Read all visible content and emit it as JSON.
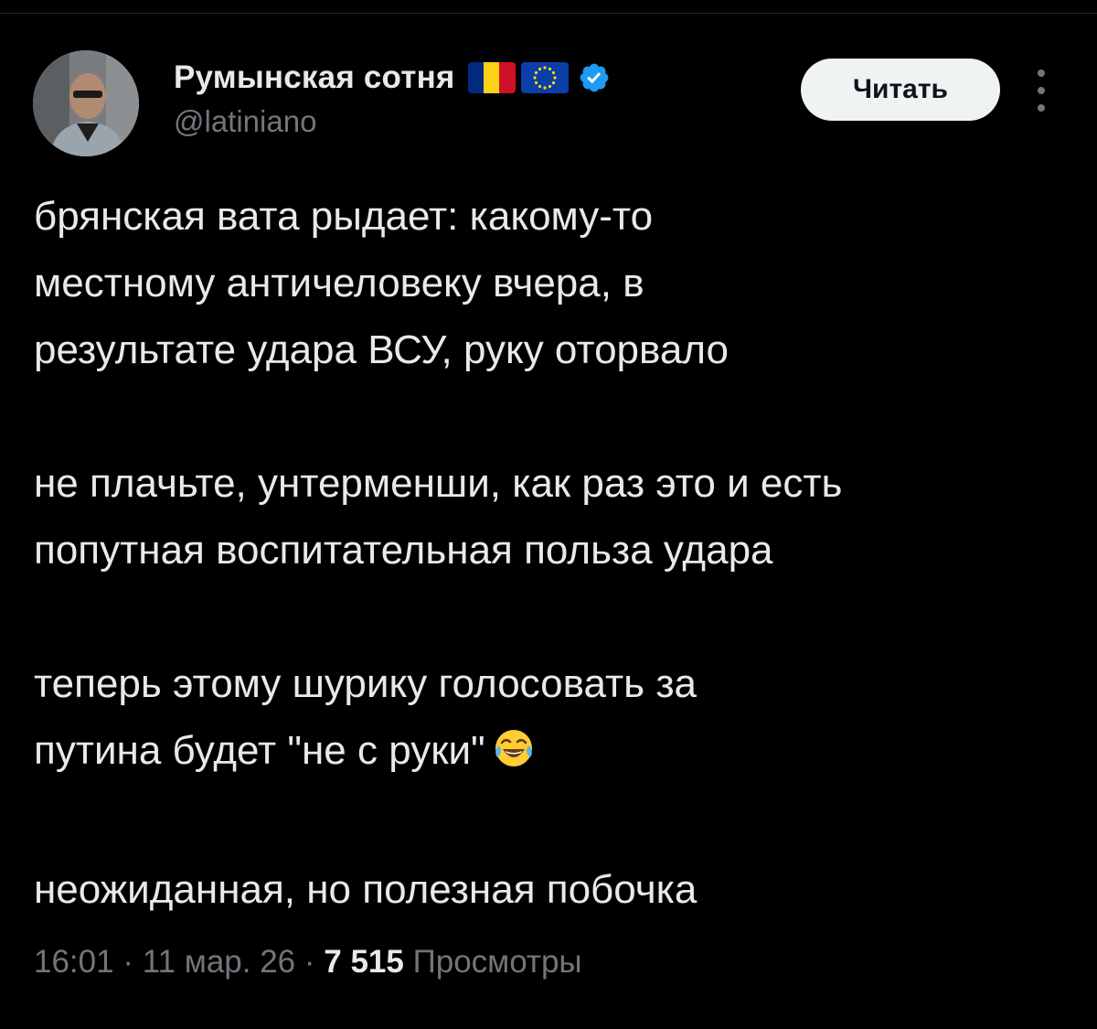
{
  "author": {
    "display_name": "Румынская сотня",
    "handle": "@latiniano"
  },
  "flags": {
    "romania": [
      "#002b7f",
      "#fcd116",
      "#ce1126"
    ],
    "eu": "#0b3ea8"
  },
  "icons": {
    "verified": "verified-badge-icon",
    "more": "more-vertical-icon",
    "emoji": "face-with-tears-of-joy"
  },
  "colors": {
    "background": "#000000",
    "text": "#e7e9ea",
    "muted": "#71767b",
    "verified": "#1d9bf0",
    "button_bg": "#eff3f4"
  },
  "follow_button": {
    "label": "Читать"
  },
  "tweet": {
    "paragraphs": [
      {
        "lines": [
          "брянская вата рыдает: какому-то",
          "местному античеловеку вчера, в",
          "результате удара ВСУ, руку оторвало"
        ]
      },
      {
        "lines": [
          "не плачьте, унтерменши, как раз это и есть",
          "попутная воспитательная польза удара"
        ]
      },
      {
        "lines": [
          "теперь этому шурику голосовать за",
          "путина будет \"не с руки\""
        ]
      },
      {
        "lines": [
          "неожиданная, но полезная побочка"
        ]
      }
    ]
  },
  "meta": {
    "time": "16:01",
    "separator": " · ",
    "date": "11 мар. 26",
    "views_count": "7 515",
    "views_label": "Просмотры"
  }
}
